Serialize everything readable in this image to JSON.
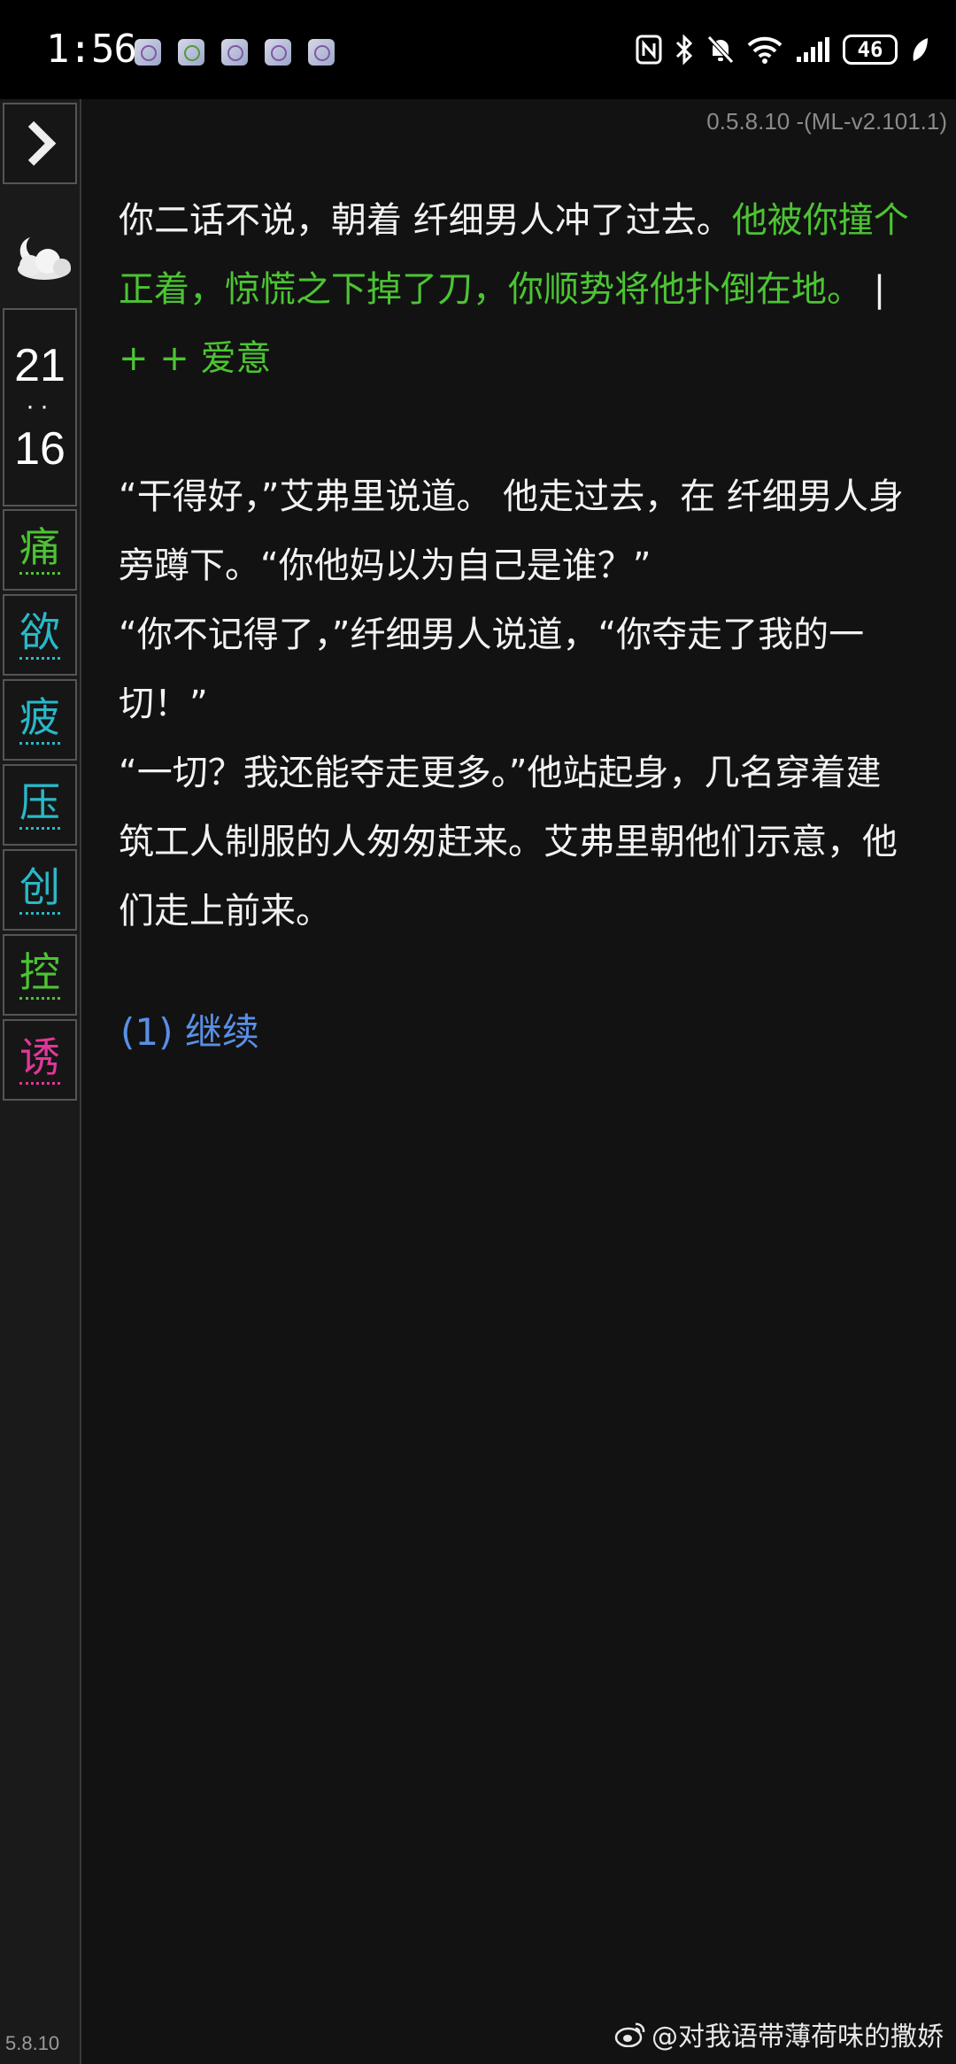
{
  "status_bar": {
    "time": "1:56",
    "notification_icons": [
      "app-notification-icon",
      "app-notification-icon",
      "app-notification-icon",
      "app-notification-icon",
      "app-notification-icon"
    ],
    "battery_level": "46"
  },
  "sidebar": {
    "toggle_icon": "chevron-right-icon",
    "weather_icon": "moon-cloud-icon",
    "clock": {
      "hour": "21",
      "separator": "··",
      "minute": "16"
    },
    "stats": [
      {
        "label": "痛",
        "color": "#4cc433"
      },
      {
        "label": "欲",
        "color": "#2ab8c8"
      },
      {
        "label": "疲",
        "color": "#2ab8c8"
      },
      {
        "label": "压",
        "color": "#2ab8c8"
      },
      {
        "label": "创",
        "color": "#2ab8c8"
      },
      {
        "label": "控",
        "color": "#4cc433"
      },
      {
        "label": "诱",
        "color": "#e0379a"
      }
    ],
    "version_short": "5.8.10"
  },
  "main": {
    "version": "0.5.8.10 -(ML-v2.101.1)",
    "para1": {
      "plain": "你二话不说，朝着 纤细男人冲了过去。",
      "green": "他被你撞个正着，惊慌之下掉了刀，你顺势将他扑倒在地。",
      "cursor": "|",
      "effect": "+ + 爱意"
    },
    "dialogue": [
      "“干得好，”艾弗里说道。 他走过去，在 纤细男人身旁蹲下。“你他妈以为自己是谁？”",
      "“你不记得了，”纤细男人说道，“你夺走了我的一切！”",
      "“一切？我还能夺走更多。”他站起身，几名穿着建筑工人制服的人匆匆赶来。艾弗里朝他们示意，他们走上前来。"
    ],
    "choice": "(1) 继续"
  },
  "watermark": "@对我语带薄荷味的撒娇"
}
